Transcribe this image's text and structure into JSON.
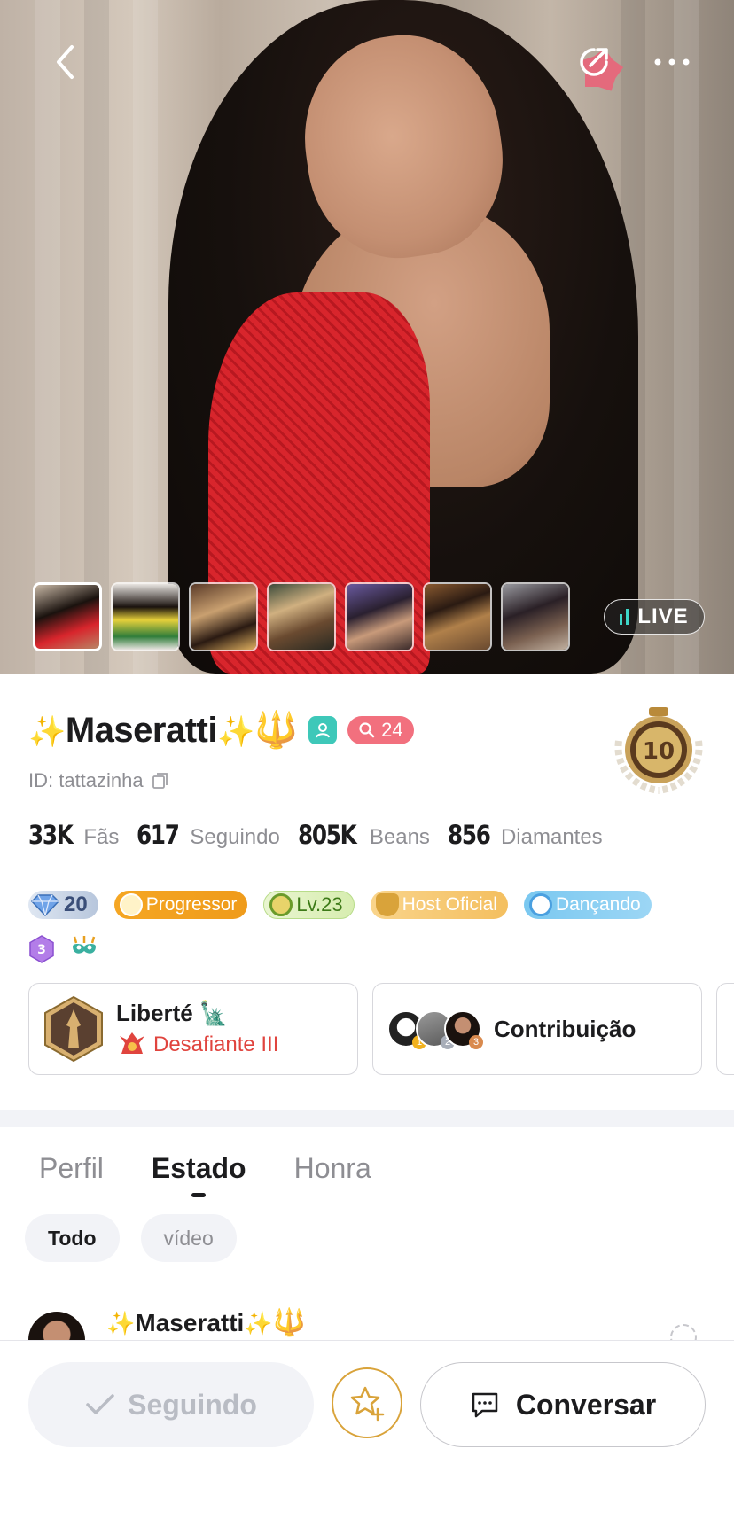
{
  "profile": {
    "name": "Maseratti",
    "id_label": "ID: tattazinha",
    "fans_badge_count": "24"
  },
  "stats": [
    {
      "value": "33K",
      "label": "Fãs"
    },
    {
      "value": "617",
      "label": "Seguindo"
    },
    {
      "value": "805K",
      "label": "Beans"
    },
    {
      "value": "856",
      "label": "Diamantes"
    }
  ],
  "badges": {
    "diamond_level": "20",
    "progressor": "Progressor",
    "level": "Lv.23",
    "host": "Host Oficial",
    "dance": "Dançando",
    "tier_number": "3"
  },
  "live": {
    "label": "LIVE"
  },
  "cards": {
    "liberte": {
      "title": "Liberté",
      "subtitle": "Desafiante III"
    },
    "contrib": {
      "title": "Contribuição",
      "ranks": [
        "1",
        "2",
        "3"
      ]
    }
  },
  "tabs": [
    {
      "label": "Perfil"
    },
    {
      "label": "Estado"
    },
    {
      "label": "Honra"
    }
  ],
  "filters": [
    {
      "label": "Todo"
    },
    {
      "label": "vídeo"
    }
  ],
  "post": {
    "author": "Maseratti"
  },
  "actions": {
    "following": "Seguindo",
    "chat": "Conversar"
  },
  "colors": {
    "accent_teal": "#3ec8b9",
    "fans_pink": "#f2707e",
    "danger_red": "#e0443e",
    "star_gold": "#d9a33a"
  }
}
